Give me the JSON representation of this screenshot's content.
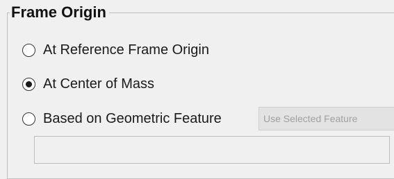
{
  "group": {
    "title": "Frame Origin"
  },
  "options": [
    {
      "label": "At Reference Frame Origin",
      "selected": false
    },
    {
      "label": "At Center of Mass",
      "selected": true
    },
    {
      "label": "Based on Geometric Feature",
      "selected": false
    }
  ],
  "feature_button": {
    "label": "Use Selected Feature",
    "enabled": false
  },
  "feature_field": {
    "value": ""
  }
}
